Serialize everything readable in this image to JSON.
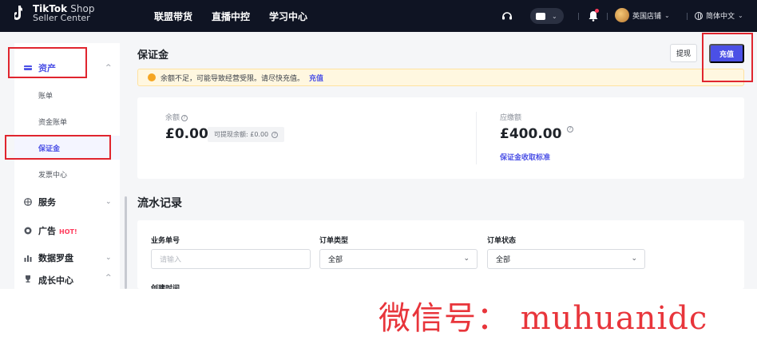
{
  "topbar": {
    "logo_brand": "TikTok",
    "logo_brand_suffix": "Shop",
    "logo_sub": "Seller Center",
    "nav": [
      "联盟带货",
      "直播中控",
      "学习中心"
    ],
    "shop_name": "英国店铺",
    "language": "简体中文"
  },
  "sidebar": {
    "assets": {
      "label": "资产"
    },
    "sub_items": [
      "账单",
      "资金账单",
      "保证金",
      "发票中心"
    ],
    "active_sub": "保证金",
    "items": [
      {
        "label": "服务"
      },
      {
        "label": "广告",
        "badge": "HOT!"
      },
      {
        "label": "数据罗盘"
      },
      {
        "label": "成长中心"
      }
    ]
  },
  "main": {
    "title": "保证金",
    "withdraw_label": "提现",
    "recharge_label": "充值",
    "alert_text": "余额不足，可能导致经营受限。请尽快充值。",
    "alert_link": "充值",
    "balance_label": "余额",
    "balance_amount": "£0.00",
    "available_label": "可提现余额: £0.00",
    "due_label": "应缴额",
    "due_amount": "£400.00",
    "due_link": "保证金收取标准",
    "records_title": "流水记录",
    "filters": {
      "order_no_label": "业务单号",
      "order_no_placeholder": "请输入",
      "order_type_label": "订单类型",
      "order_type_value": "全部",
      "order_status_label": "订单状态",
      "order_status_value": "全部",
      "created_label": "创建时间"
    }
  },
  "watermark": "微信号： muhuanidc",
  "colors": {
    "accent": "#4b50e6",
    "topbar": "#0f1423",
    "highlight_box": "#e0252e",
    "alert_bg": "#fff7e0"
  }
}
